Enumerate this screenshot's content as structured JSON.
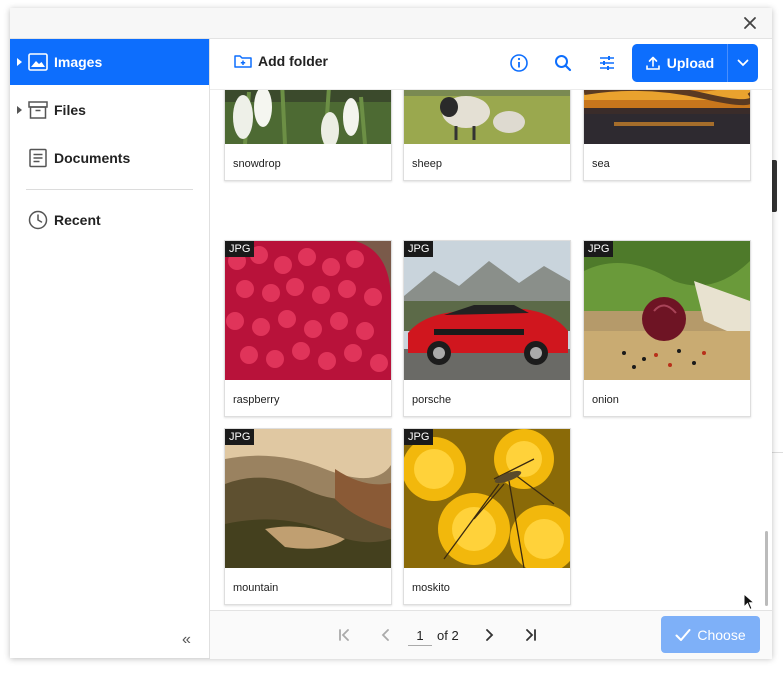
{
  "sidebar": {
    "items": [
      {
        "label": "Images",
        "icon": "image-icon",
        "active": true,
        "has_caret": true
      },
      {
        "label": "Files",
        "icon": "archive-icon",
        "active": false,
        "has_caret": true
      },
      {
        "label": "Documents",
        "icon": "document-icon",
        "active": false,
        "has_caret": false
      },
      {
        "label": "Recent",
        "icon": "clock-icon",
        "active": false,
        "has_caret": false
      }
    ],
    "collapse_label": "«"
  },
  "toolbar": {
    "add_folder_label": "Add folder",
    "upload_label": "Upload"
  },
  "grid": {
    "items": [
      {
        "name": "snowdrop",
        "badge": ""
      },
      {
        "name": "sheep",
        "badge": ""
      },
      {
        "name": "sea",
        "badge": ""
      },
      {
        "name": "raspberry",
        "badge": "JPG"
      },
      {
        "name": "porsche",
        "badge": "JPG"
      },
      {
        "name": "onion",
        "badge": "JPG"
      },
      {
        "name": "mountain",
        "badge": "JPG"
      },
      {
        "name": "moskito",
        "badge": "JPG"
      }
    ]
  },
  "pagination": {
    "current_page": "1",
    "of_label": "of 2"
  },
  "footer": {
    "choose_label": "Choose"
  },
  "colors": {
    "accent": "#0d6efd",
    "choose_disabled": "#7eb0f8"
  }
}
